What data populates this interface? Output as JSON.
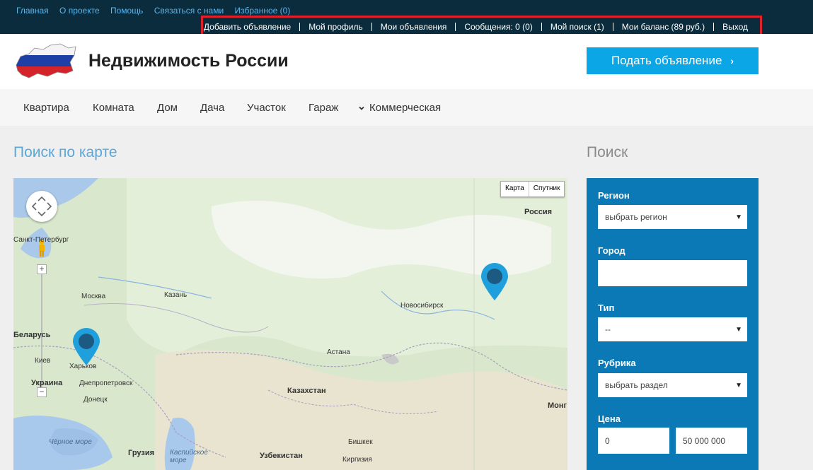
{
  "top_links": [
    "Главная",
    "О проекте",
    "Помощь",
    "Связаться с нами",
    "Избранное (0)"
  ],
  "user_menu": [
    "Добавить объявление",
    "Мой профиль",
    "Мои объявления",
    "Сообщения: 0 (0)",
    "Мой поиск (1)",
    "Мои баланс (89 руб.)",
    "Выход"
  ],
  "header": {
    "title": "Недвижимость России",
    "cta": "Подать объявление"
  },
  "nav": [
    "Квартира",
    "Комната",
    "Дом",
    "Дача",
    "Участок",
    "Гараж",
    "Коммерческая"
  ],
  "map": {
    "title": "Поиск по карте",
    "types": [
      "Карта",
      "Спутник"
    ],
    "labels": {
      "russia": "Россия",
      "stpete": "Санкт-Петербург",
      "moscow": "Москва",
      "kazan": "Казань",
      "novosibirsk": "Новосибирск",
      "belarus": "Беларусь",
      "kiev": "Киев",
      "kharkov": "Харьков",
      "ukraine": "Украина",
      "dnepro": "Днепропетровск",
      "donetsk": "Донецк",
      "astana": "Астана",
      "kazakhstan": "Казахстан",
      "blacksea": "Чёрное море",
      "georgia": "Грузия",
      "caspian": "Каспийское море",
      "uzbekistan": "Узбекистан",
      "bishkek": "Бишкек",
      "kyrgyzstan": "Киргизия",
      "mong": "Монг"
    }
  },
  "search": {
    "title": "Поиск",
    "region_label": "Регион",
    "region_value": "выбрать регион",
    "city_label": "Город",
    "city_value": "",
    "type_label": "Тип",
    "type_value": "--",
    "rubric_label": "Рубрика",
    "rubric_value": "выбрать раздел",
    "price_label": "Цена",
    "price_from": "0",
    "price_to": "50 000 000"
  },
  "colors": {
    "topbar": "#0b2c3d",
    "accent": "#0aa6e6",
    "panel": "#0b79b5",
    "highlight": "#e0202a",
    "link": "#56b6f0"
  }
}
